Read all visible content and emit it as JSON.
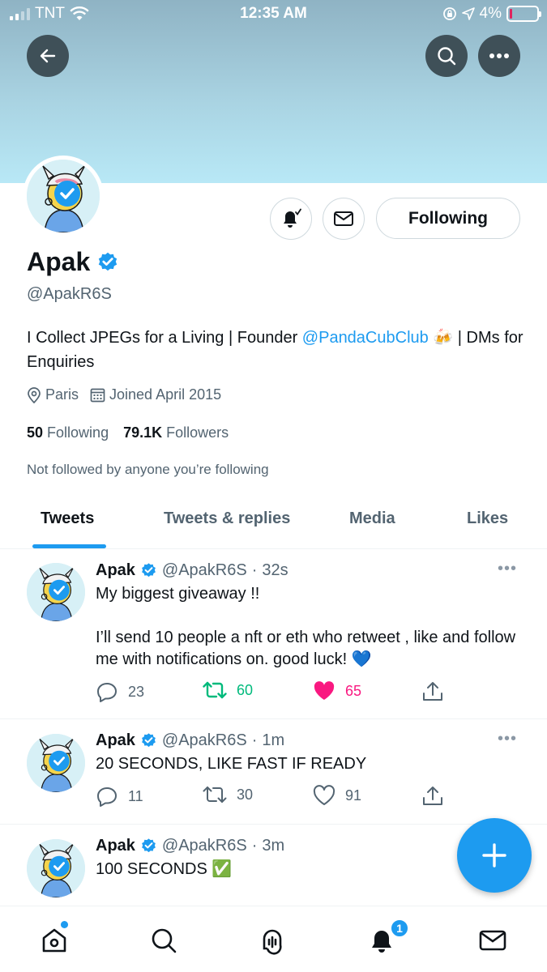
{
  "status_bar": {
    "carrier": "TNT",
    "time": "12:35 AM",
    "battery": "4%"
  },
  "profile": {
    "name": "Apak",
    "handle": "@ApakR6S",
    "bio_prefix": "I Collect JPEGs for a Living | Founder ",
    "bio_mention": "@PandaCubClub",
    "bio_emoji": "🍻",
    "bio_suffix": " | DMs for Enquiries",
    "location": "Paris",
    "joined": "Joined April 2015",
    "following_count": "50",
    "following_label": "Following",
    "followers_count": "79.1K",
    "followers_label": "Followers",
    "not_followed_text": "Not followed by anyone you’re following",
    "follow_button_label": "Following"
  },
  "tabs": [
    {
      "label": "Tweets",
      "active": true
    },
    {
      "label": "Tweets & replies",
      "active": false
    },
    {
      "label": "Media",
      "active": false
    },
    {
      "label": "Likes",
      "active": false
    }
  ],
  "tweets": [
    {
      "name": "Apak",
      "handle": "@ApakR6S",
      "time": "32s",
      "text_line1": "My biggest giveaway !!",
      "text_line2": "I’ll send 10 people a nft or eth who retweet , like and follow me with notifications on. good luck! 💙",
      "replies": "23",
      "retweets": "60",
      "likes": "65",
      "retweeted": true,
      "liked": true
    },
    {
      "name": "Apak",
      "handle": "@ApakR6S",
      "time": "1m",
      "text_line1": "20 SECONDS, LIKE FAST IF READY",
      "replies": "11",
      "retweets": "30",
      "likes": "91",
      "retweeted": false,
      "liked": false
    },
    {
      "name": "Apak",
      "handle": "@ApakR6S",
      "time": "3m",
      "text_line1": "100 SECONDS ✅"
    }
  ],
  "bottom_nav": {
    "notifications_badge": "1"
  },
  "colors": {
    "accent": "#1d9bf0",
    "retweet_green": "#00ba7c",
    "like_pink": "#f91880",
    "text_secondary": "#536471"
  }
}
